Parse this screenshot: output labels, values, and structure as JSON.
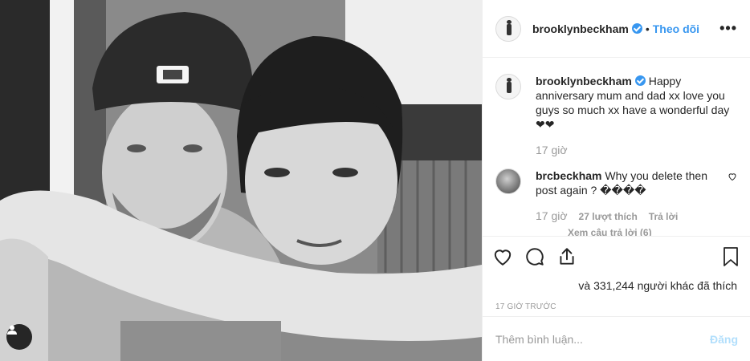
{
  "post": {
    "photo": {
      "alt_icon": "user-tag-icon"
    },
    "header": {
      "username": "brooklynbeckham",
      "separator": "•",
      "follow_label": "Theo dõi",
      "more_label": "•••"
    },
    "caption": {
      "username": "brooklynbeckham",
      "text": "Happy anniversary mum and dad xx love you guys so much xx have a wonderful day ❤❤",
      "time": "17 giờ"
    },
    "comments": [
      {
        "username": "brcbeckham",
        "text": "Why you delete then post again ? ����",
        "time": "17 giờ",
        "likes_label": "27 lượt thích",
        "reply_label": "Trả lời"
      }
    ],
    "view_replies_label": "Xem câu trả lời (6)",
    "likes_text": "và 331,244 người khác đã thích",
    "timestamp": "17 GIỜ TRƯỚC",
    "add_comment": {
      "placeholder": "Thêm bình luận...",
      "post_label": "Đăng"
    },
    "colors": {
      "accent": "#3897f0",
      "muted": "#999999",
      "post_disabled": "#b2dffc",
      "border": "#efefef"
    }
  }
}
